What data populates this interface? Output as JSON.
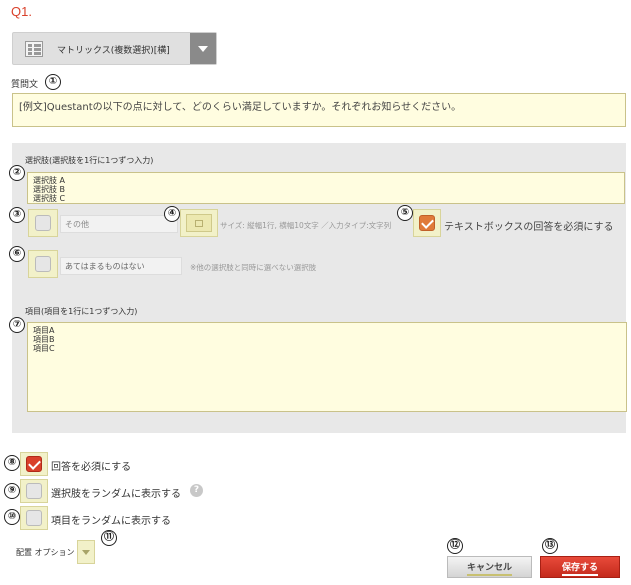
{
  "question": {
    "number": "Q1.",
    "type_label": "マトリックス(複数選択)[横]",
    "text_label": "質問文",
    "text_value": "[例文]Questantの以下の点に対して、どのくらい満足していますか。それぞれお知らせください。"
  },
  "choices": {
    "label": "選択肢(選択肢を1行に1つずつ入力)",
    "items": [
      "選択肢 A",
      "選択肢 B",
      "選択肢 C"
    ],
    "other_placeholder": "その他",
    "textbox_hint": "サイズ: 縦幅1行, 横幅10文字 ／入力タイプ:文字列",
    "require_textbox_label": "テキストボックスの回答を必須にする",
    "none_placeholder": "あてはまるものはない",
    "none_hint": "※他の選択肢と同時に選べない選択肢"
  },
  "items": {
    "label": "項目(項目を1行に1つずつ入力)",
    "rows": [
      "項目A",
      "項目B",
      "項目C"
    ]
  },
  "options": {
    "required_label": "回答を必須にする",
    "random_choices_label": "選択肢をランダムに表示する",
    "random_items_label": "項目をランダムに表示する",
    "layout_label": "配置 オプション",
    "help_icon": "?"
  },
  "buttons": {
    "cancel": "キャンセル",
    "save": "保存する"
  },
  "markers": [
    "①",
    "②",
    "③",
    "④",
    "⑤",
    "⑥",
    "⑦",
    "⑧",
    "⑨",
    "⑩",
    "⑪",
    "⑫",
    "⑬"
  ],
  "colors": {
    "accent": "#d9402a",
    "field_bg": "#fffde0",
    "panel_bg": "#e8e8e8"
  }
}
